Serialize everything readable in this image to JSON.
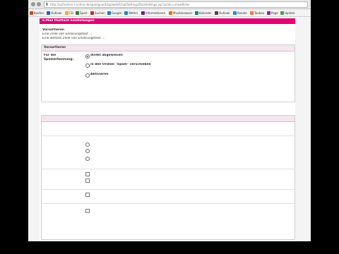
{
  "browser": {
    "url": "http://aufnahme.t-online.de/spamguard/jsp/web/EmailSettings/RuleSettings.jsp?action=showRules"
  },
  "bookmarks": [
    {
      "label": "Kaufen",
      "icon": "bookmark-icon",
      "color": "#d84315"
    },
    {
      "label": "Outlook",
      "icon": "outlook-icon",
      "color": "#1565c0"
    },
    {
      "label": "CD",
      "icon": "folder-icon",
      "color": "#f9a825"
    },
    {
      "label": "Sport",
      "icon": "bookmark-icon",
      "color": "#2e7d32"
    },
    {
      "label": "Suchen",
      "icon": "bookmark-icon",
      "color": "#c62828"
    },
    {
      "label": "Google",
      "icon": "google-icon",
      "color": "#1976d2"
    },
    {
      "label": "Wetter",
      "icon": "bookmark-icon",
      "color": "#0288d1"
    },
    {
      "label": "Informationen",
      "icon": "info-icon",
      "color": "#6a1b9a"
    },
    {
      "label": "Musikbrowser",
      "icon": "music-icon",
      "color": "#ef6c00"
    },
    {
      "label": "Kalender",
      "icon": "calendar-icon",
      "color": "#00897b"
    },
    {
      "label": "Outlook",
      "icon": "outlook-icon",
      "color": "#5d4037"
    },
    {
      "label": "Reader",
      "icon": "reader-icon",
      "color": "#1e88e5"
    },
    {
      "label": "Taobao",
      "icon": "bookmark-icon",
      "color": "#ff7043"
    },
    {
      "label": "Page",
      "icon": "bookmark-icon",
      "color": "#8e24aa"
    },
    {
      "label": "Update",
      "icon": "update-icon",
      "color": "#43a047"
    }
  ],
  "page": {
    "header": "E-Mail Postfach Einstellungen",
    "intro": {
      "title": "Vorsortieren",
      "lines": [
        "Eine Zeile von Erklärungstext …",
        "Eine weitere Zeile von Erklärungstext …"
      ]
    },
    "sections": {
      "spam": {
        "head": "Vorsortieren",
        "left_label": "Für die Spamerkennung:",
        "options": [
          {
            "label": "direkt abgewiesen",
            "text": "",
            "text2": "",
            "checked": true
          },
          {
            "label": "in den Ordner \"Spam\" verschieben",
            "text": "",
            "text2": "",
            "checked": false
          },
          {
            "label": "Aktivieren",
            "text": "",
            "text2": "",
            "checked": false
          }
        ],
        "note": ""
      },
      "plus": {
        "head": "",
        "lines": [
          "",
          ""
        ],
        "rows": [
          {
            "left": "",
            "options": [
              "",
              "",
              ""
            ]
          },
          {
            "left": "",
            "options": [
              "",
              ""
            ]
          },
          {
            "left": "",
            "options": [
              ""
            ]
          },
          {
            "left": "",
            "options": [
              ""
            ]
          }
        ]
      }
    },
    "footer": ""
  },
  "colors": {
    "accent": "#e20074",
    "section_head_bg": "#f4e6ee"
  }
}
